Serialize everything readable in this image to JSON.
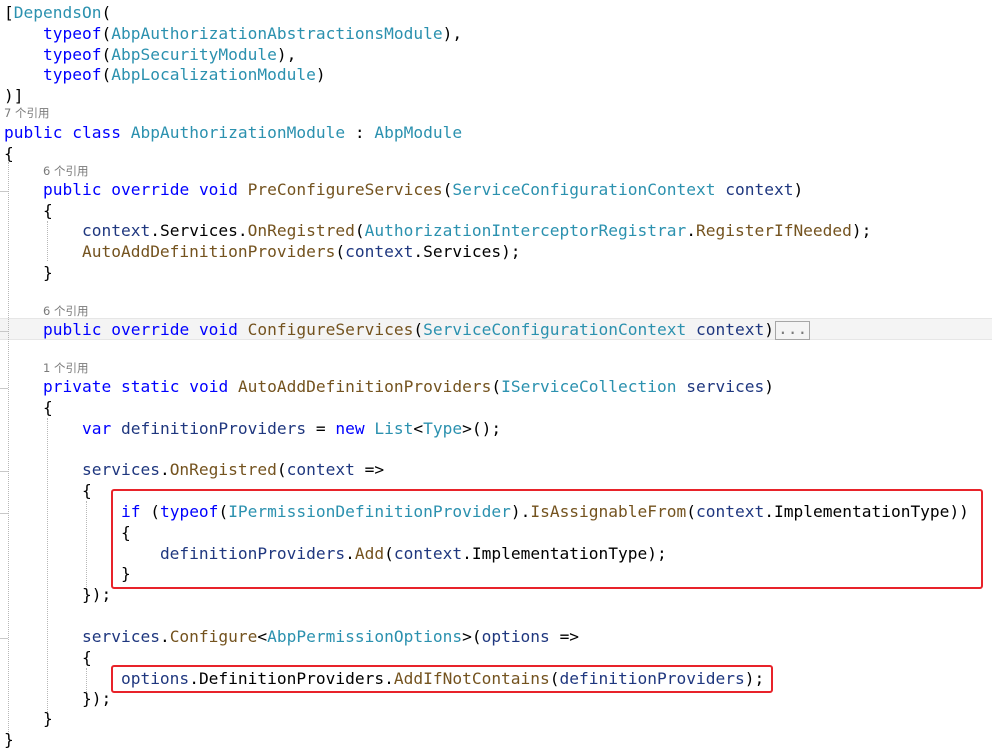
{
  "colors": {
    "keyword": "#0000ff",
    "type": "#2b91af",
    "method": "#74531f",
    "parameter": "#1f377f",
    "codelens": "#7a7a7a",
    "highlight_box": "#e8232a"
  },
  "codelens": {
    "class_refs": "7 个引用",
    "preconfigure_refs": "6 个引用",
    "configure_refs": "6 个引用",
    "autoadd_refs": "1 个引用"
  },
  "collapsed_indicator": "...",
  "tokens": {
    "open_bracket": "[",
    "depends_on": "DependsOn",
    "open_paren": "(",
    "close_paren": ")",
    "comma": ",",
    "close_attr": ")]",
    "typeof": "typeof",
    "abp_authorization_abstractions_module": "AbpAuthorizationAbstractionsModule",
    "abp_security_module": "AbpSecurityModule",
    "abp_localization_module": "AbpLocalizationModule",
    "public": "public",
    "class": "class",
    "abp_authorization_module": "AbpAuthorizationModule",
    "colon": ":",
    "abp_module": "AbpModule",
    "open_brace": "{",
    "close_brace": "}",
    "override": "override",
    "void": "void",
    "pre_configure_services": "PreConfigureServices",
    "service_configuration_context": "ServiceConfigurationContext",
    "context": "context",
    "dot": ".",
    "services_prop": "Services",
    "on_registred": "OnRegistred",
    "authorization_interceptor_registrar": "AuthorizationInterceptorRegistrar",
    "register_if_needed": "RegisterIfNeeded",
    "semicolon_paren": ");",
    "auto_add_definition_providers": "AutoAddDefinitionProviders",
    "configure_services": "ConfigureServices",
    "private": "private",
    "static": "static",
    "iservice_collection": "IServiceCollection",
    "services": "services",
    "var": "var",
    "definition_providers": "definitionProviders",
    "equals": "=",
    "new": "new",
    "list": "List",
    "lt": "<",
    "gt": ">",
    "type": "Type",
    "empty_call_end": "();",
    "arrow": "=>",
    "if": "if",
    "ipermission_definition_provider": "IPermissionDefinitionProvider",
    "is_assignable_from": "IsAssignableFrom",
    "implementation_type": "ImplementationType",
    "double_close": "))",
    "add": "Add",
    "close_lambda": "});",
    "configure": "Configure",
    "abp_permission_options": "AbpPermissionOptions",
    "options": "options",
    "definition_providers_prop": "DefinitionProviders",
    "add_if_not_contains": "AddIfNotContains"
  }
}
